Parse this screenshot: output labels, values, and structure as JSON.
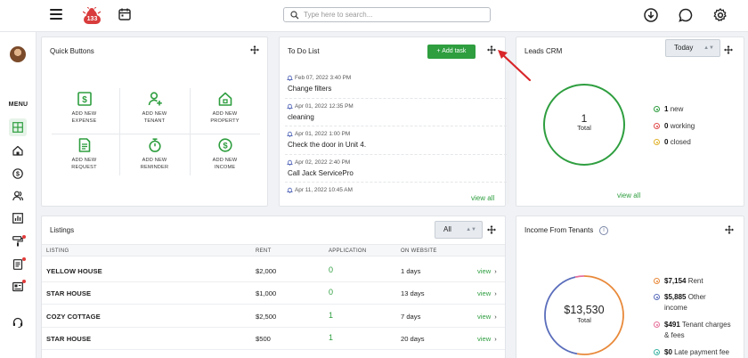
{
  "header": {
    "notification_count": "133",
    "search_placeholder": "Type here to search..."
  },
  "sidebar": {
    "menu_label": "MENU"
  },
  "colors": {
    "accent": "#2e9e3f",
    "badge": "#d93c3c",
    "rent": "#e8893a",
    "other_income": "#5a6dbb",
    "tenant_charges": "#e76f9a",
    "late_fee": "#3bb3a3"
  },
  "quick_buttons": {
    "title": "Quick Buttons",
    "items": [
      {
        "label_1": "ADD NEW",
        "label_2": "EXPENSE",
        "icon": "dollar-bill-icon"
      },
      {
        "label_1": "ADD NEW",
        "label_2": "TENANT",
        "icon": "add-person-icon"
      },
      {
        "label_1": "ADD NEW",
        "label_2": "PROPERTY",
        "icon": "house-icon"
      },
      {
        "label_1": "ADD NEW",
        "label_2": "REQUEST",
        "icon": "document-icon"
      },
      {
        "label_1": "ADD NEW",
        "label_2": "REMINDER",
        "icon": "stopwatch-icon"
      },
      {
        "label_1": "ADD NEW",
        "label_2": "INCOME",
        "icon": "dollar-circle-icon"
      }
    ]
  },
  "todo": {
    "title": "To Do List",
    "add_task": "+ Add task",
    "view_all": "view all",
    "items": [
      {
        "date": "Feb 07, 2022 3:40 PM",
        "text": "Change filters"
      },
      {
        "date": "Apr 01, 2022 12:35 PM",
        "text": "cleaning"
      },
      {
        "date": "Apr 01, 2022 1:00 PM",
        "text": "Check the door in Unit 4."
      },
      {
        "date": "Apr 02, 2022 2:40 PM",
        "text": "Call Jack ServicePro"
      },
      {
        "date": "Apr 11, 2022 10:45 AM",
        "text": ""
      }
    ]
  },
  "leads": {
    "title": "Leads CRM",
    "filter": "Today",
    "total_value": "1",
    "total_label": "Total",
    "view_all": "view all",
    "legend": [
      {
        "count": "1",
        "label": "new",
        "color": "#2e9e3f"
      },
      {
        "count": "0",
        "label": "working",
        "color": "#e04b4b"
      },
      {
        "count": "0",
        "label": "closed",
        "color": "#e0b12a"
      }
    ]
  },
  "listings": {
    "title": "Listings",
    "filter": "All",
    "columns": [
      "LISTING",
      "RENT",
      "APPLICATION",
      "ON WEBSITE"
    ],
    "rows": [
      {
        "name": "YELLOW HOUSE",
        "rent": "$2,000",
        "application": "0",
        "on_website": "1 days",
        "action": "view"
      },
      {
        "name": "STAR HOUSE",
        "rent": "$1,000",
        "application": "0",
        "on_website": "13 days",
        "action": "view"
      },
      {
        "name": "COZY COTTAGE",
        "rent": "$2,500",
        "application": "1",
        "on_website": "7 days",
        "action": "view"
      },
      {
        "name": "STAR HOUSE",
        "rent": "$500",
        "application": "1",
        "on_website": "20 days",
        "action": "view"
      }
    ]
  },
  "income": {
    "title": "Income From Tenants",
    "total_value": "$13,530",
    "total_label": "Total",
    "legend": [
      {
        "amount": "$7,154",
        "label": "Rent",
        "color": "#e8893a"
      },
      {
        "amount": "$5,885",
        "label": "Other",
        "label_2": "income",
        "color": "#5a6dbb"
      },
      {
        "amount": "$491",
        "label": "Tenant charges",
        "label_2": "& fees",
        "color": "#e76f9a"
      },
      {
        "amount": "$0",
        "label": "Late payment fee",
        "color": "#3bb3a3"
      }
    ]
  }
}
